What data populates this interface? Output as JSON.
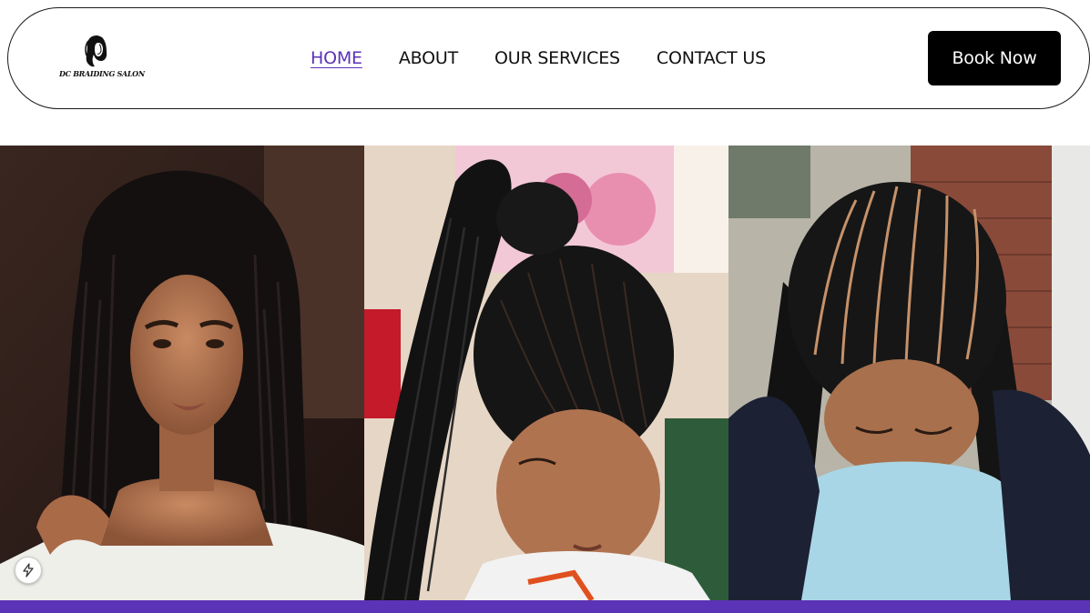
{
  "brand": {
    "logo_text": "DC BRAIDING SALON",
    "logo_icon": "woman-silhouette-icon"
  },
  "nav": {
    "items": [
      {
        "label": "HOME",
        "active": true
      },
      {
        "label": "ABOUT",
        "active": false
      },
      {
        "label": "OUR SERVICES",
        "active": false
      },
      {
        "label": "CONTACT US",
        "active": false
      }
    ],
    "active_color": "#5b33b6"
  },
  "cta": {
    "label": "Book Now"
  },
  "gallery": {
    "images": [
      {
        "subject": "woman with long box braids"
      },
      {
        "subject": "stitch braids high ponytail"
      },
      {
        "subject": "straight-back feed-in cornrows"
      }
    ]
  },
  "colors": {
    "accent": "#5b33b6",
    "button_bg": "#000000",
    "button_text": "#ffffff"
  },
  "badge": {
    "icon": "lightning-bolt-icon"
  }
}
